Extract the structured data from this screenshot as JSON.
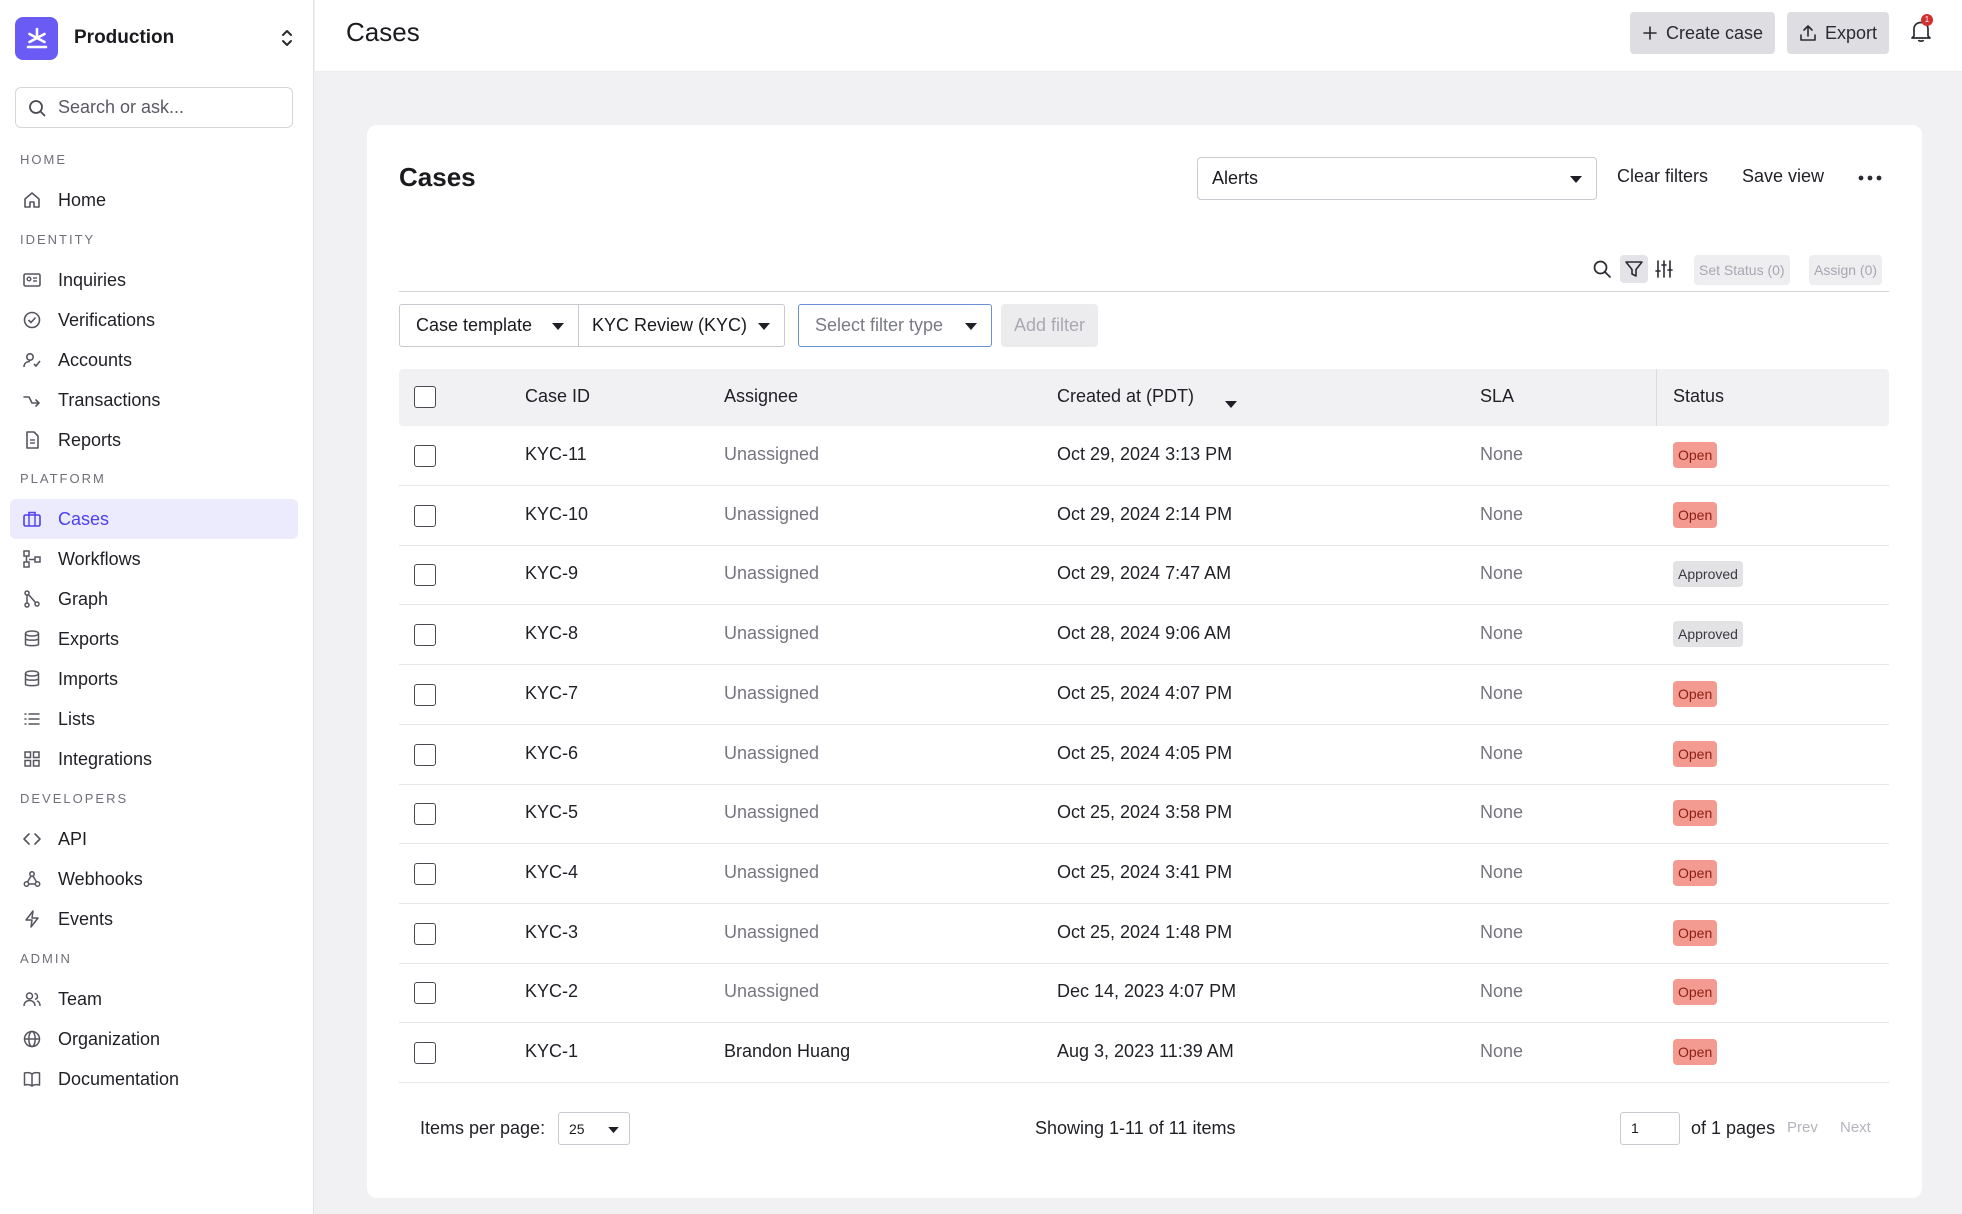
{
  "sidebar": {
    "org_name": "Production",
    "search_placeholder": "Search or ask...",
    "sections": {
      "home": "HOME",
      "identity": "IDENTITY",
      "platform": "PLATFORM",
      "developers": "DEVELOPERS",
      "admin": "ADMIN"
    },
    "items": {
      "home": "Home",
      "inquiries": "Inquiries",
      "verifications": "Verifications",
      "accounts": "Accounts",
      "transactions": "Transactions",
      "reports": "Reports",
      "cases": "Cases",
      "workflows": "Workflows",
      "graph": "Graph",
      "exports": "Exports",
      "imports": "Imports",
      "lists": "Lists",
      "integrations": "Integrations",
      "api": "API",
      "webhooks": "Webhooks",
      "events": "Events",
      "team": "Team",
      "organization": "Organization",
      "documentation": "Documentation"
    },
    "active_item": "cases"
  },
  "topbar": {
    "title": "Cases",
    "create_label": "Create case",
    "export_label": "Export",
    "notification_count": "1"
  },
  "card": {
    "title": "Cases",
    "view_select": "Alerts",
    "clear_filters": "Clear filters",
    "save_view": "Save view",
    "set_status": "Set Status (0)",
    "assign": "Assign (0)"
  },
  "filters": {
    "template_label": "Case template",
    "template_value": "KYC Review (KYC)",
    "filter_type_placeholder": "Select filter type",
    "add_filter": "Add filter"
  },
  "table": {
    "headers": {
      "case_id": "Case ID",
      "assignee": "Assignee",
      "created_at": "Created at (PDT)",
      "sla": "SLA",
      "status": "Status"
    },
    "rows": [
      {
        "id": "KYC-11",
        "assignee": "Unassigned",
        "created": "Oct 29, 2024 3:13 PM",
        "sla": "None",
        "status": "Open"
      },
      {
        "id": "KYC-10",
        "assignee": "Unassigned",
        "created": "Oct 29, 2024 2:14 PM",
        "sla": "None",
        "status": "Open"
      },
      {
        "id": "KYC-9",
        "assignee": "Unassigned",
        "created": "Oct 29, 2024 7:47 AM",
        "sla": "None",
        "status": "Approved"
      },
      {
        "id": "KYC-8",
        "assignee": "Unassigned",
        "created": "Oct 28, 2024 9:06 AM",
        "sla": "None",
        "status": "Approved"
      },
      {
        "id": "KYC-7",
        "assignee": "Unassigned",
        "created": "Oct 25, 2024 4:07 PM",
        "sla": "None",
        "status": "Open"
      },
      {
        "id": "KYC-6",
        "assignee": "Unassigned",
        "created": "Oct 25, 2024 4:05 PM",
        "sla": "None",
        "status": "Open"
      },
      {
        "id": "KYC-5",
        "assignee": "Unassigned",
        "created": "Oct 25, 2024 3:58 PM",
        "sla": "None",
        "status": "Open"
      },
      {
        "id": "KYC-4",
        "assignee": "Unassigned",
        "created": "Oct 25, 2024 3:41 PM",
        "sla": "None",
        "status": "Open"
      },
      {
        "id": "KYC-3",
        "assignee": "Unassigned",
        "created": "Oct 25, 2024 1:48 PM",
        "sla": "None",
        "status": "Open"
      },
      {
        "id": "KYC-2",
        "assignee": "Unassigned",
        "created": "Dec 14, 2023 4:07 PM",
        "sla": "None",
        "status": "Open"
      },
      {
        "id": "KYC-1",
        "assignee": "Brandon Huang",
        "created": "Aug 3, 2023 11:39 AM",
        "sla": "None",
        "status": "Open"
      }
    ]
  },
  "footer": {
    "items_per_page_label": "Items per page:",
    "items_per_page_value": "25",
    "showing": "Showing 1-11 of 11 items",
    "page_value": "1",
    "of_pages": "of 1 pages",
    "prev": "Prev",
    "next": "Next"
  },
  "colors": {
    "accent": "#6b5bf5",
    "active_bg": "#ecebfd",
    "open_badge": "#f39a91",
    "approved_badge": "#e3e3e6"
  }
}
